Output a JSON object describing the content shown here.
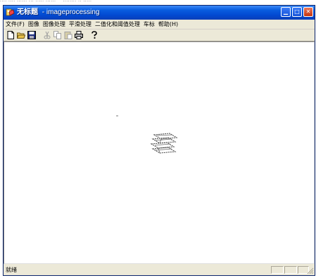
{
  "window": {
    "document_name": "无标题",
    "separator": " - ",
    "app_name": "imageprocessing",
    "title_icon": "app-icon",
    "controls": {
      "minimize_icon": "minimize-icon",
      "maximize_icon": "maximize-icon",
      "close_icon": "close-icon"
    },
    "title_bar_color": "#0a5ee0"
  },
  "menubar": {
    "items": [
      {
        "label": "文件(F)"
      },
      {
        "label": "图像"
      },
      {
        "label": "图像处理"
      },
      {
        "label": "平滑处理"
      },
      {
        "label": "二值化和阈值处理"
      },
      {
        "label": "车标"
      },
      {
        "label": "帮助(H)"
      }
    ]
  },
  "toolbar": {
    "buttons": [
      {
        "icon": "new-file-icon",
        "enabled": true
      },
      {
        "icon": "open-folder-icon",
        "enabled": true
      },
      {
        "icon": "save-icon",
        "enabled": true
      },
      {
        "icon": "cut-icon",
        "enabled": false
      },
      {
        "icon": "copy-icon",
        "enabled": false
      },
      {
        "icon": "paste-icon",
        "enabled": false
      },
      {
        "icon": "print-icon",
        "enabled": true
      },
      {
        "icon": "help-icon",
        "enabled": true
      }
    ]
  },
  "canvas": {
    "background": "#ffffff",
    "image_description_icon": "car-logo-icon"
  },
  "statusbar": {
    "text": "就绪"
  }
}
